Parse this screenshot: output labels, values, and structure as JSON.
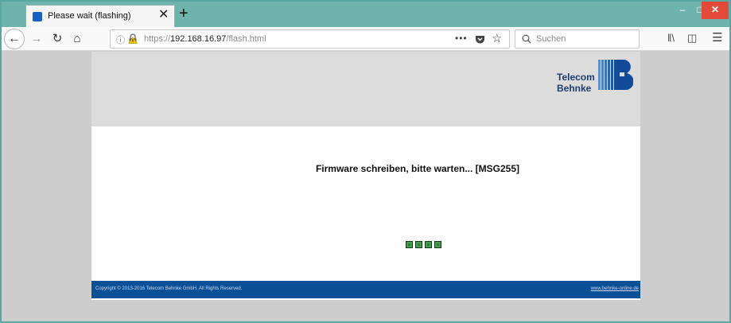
{
  "browser": {
    "tab_title": "Please wait (flashing)",
    "url_scheme": "https://",
    "url_host": "192.168.16.97",
    "url_path": "/flash.html",
    "search_placeholder": "Suchen",
    "new_tab_glyph": "+",
    "tab_close_glyph": "✕",
    "page_actions_glyph": "•••"
  },
  "page": {
    "logo_line1": "Telecom",
    "logo_line2": "Behnke",
    "message": "Firmware schreiben, bitte warten... [MSG255]",
    "progress_blocks": 4,
    "footer_copyright": "Copyright © 2013-2016 Telecom Behnke GmbH. All Rights Reserved.",
    "footer_link": "www.behnke-online.de"
  },
  "colors": {
    "tabbar": "#6eb4ac",
    "brand_blue": "#0b4f96",
    "progress_green": "#2f7f3a",
    "close_red": "#e44a3a"
  }
}
